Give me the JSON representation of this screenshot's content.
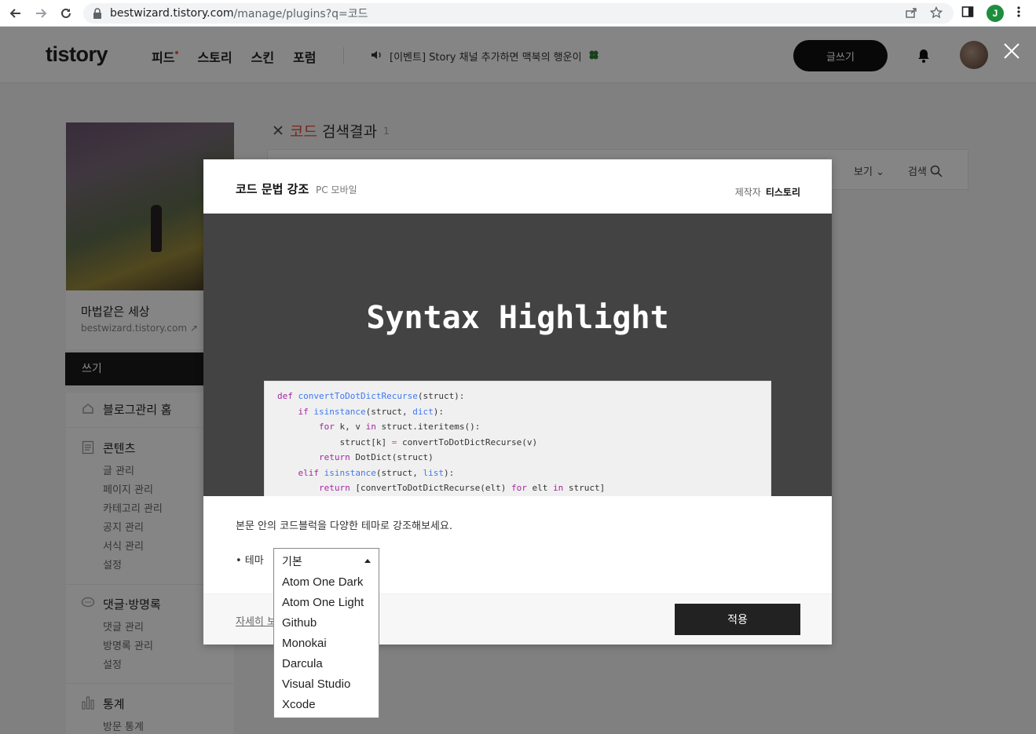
{
  "browser": {
    "url_host": "bestwizard.tistory.com",
    "url_path": "/manage/plugins?q=코드",
    "profile_initial": "J"
  },
  "header": {
    "logo": "tistory",
    "nav": [
      "피드",
      "스토리",
      "스킨",
      "포럼"
    ],
    "event": "[이벤트] Story 채널 추가하면 맥북의 행운이",
    "write_button": "글쓰기"
  },
  "blog": {
    "name": "마법같은 세상",
    "url": "bestwizard.tistory.com"
  },
  "sidebar": {
    "write": "쓰기",
    "home": "블로그관리 홈",
    "content_title": "콘텐츠",
    "content_items": [
      "글 관리",
      "페이지 관리",
      "카테고리 관리",
      "공지 관리",
      "서식 관리",
      "설정"
    ],
    "comment_title": "댓글·방명록",
    "comment_items": [
      "댓글 관리",
      "방명록 관리",
      "설정"
    ],
    "stats_title": "통계",
    "stats_items": [
      "방문 통계"
    ]
  },
  "search": {
    "query": "코드",
    "suffix": "검색결과",
    "count": "1",
    "view_label": "보기",
    "search_label": "검색"
  },
  "modal": {
    "title": "코드 문법 강조",
    "platform": "PC 모바일",
    "maker_label": "제작자",
    "maker": "티스토리",
    "preview_title": "Syntax Highlight",
    "description": "본문 안의 코드블럭을 다양한 테마로 강조해보세요.",
    "theme_label": "•  테마",
    "more_link": "자세히 보기",
    "apply_button": "적용"
  },
  "theme_select": {
    "selected": "기본",
    "options": [
      "Atom One Dark",
      "Atom One Light",
      "Github",
      "Monokai",
      "Darcula",
      "Visual Studio",
      "Xcode"
    ]
  },
  "colors": {
    "accent_query": "#e54a3b",
    "button_dark": "#222222",
    "preview_bg": "#434343"
  }
}
